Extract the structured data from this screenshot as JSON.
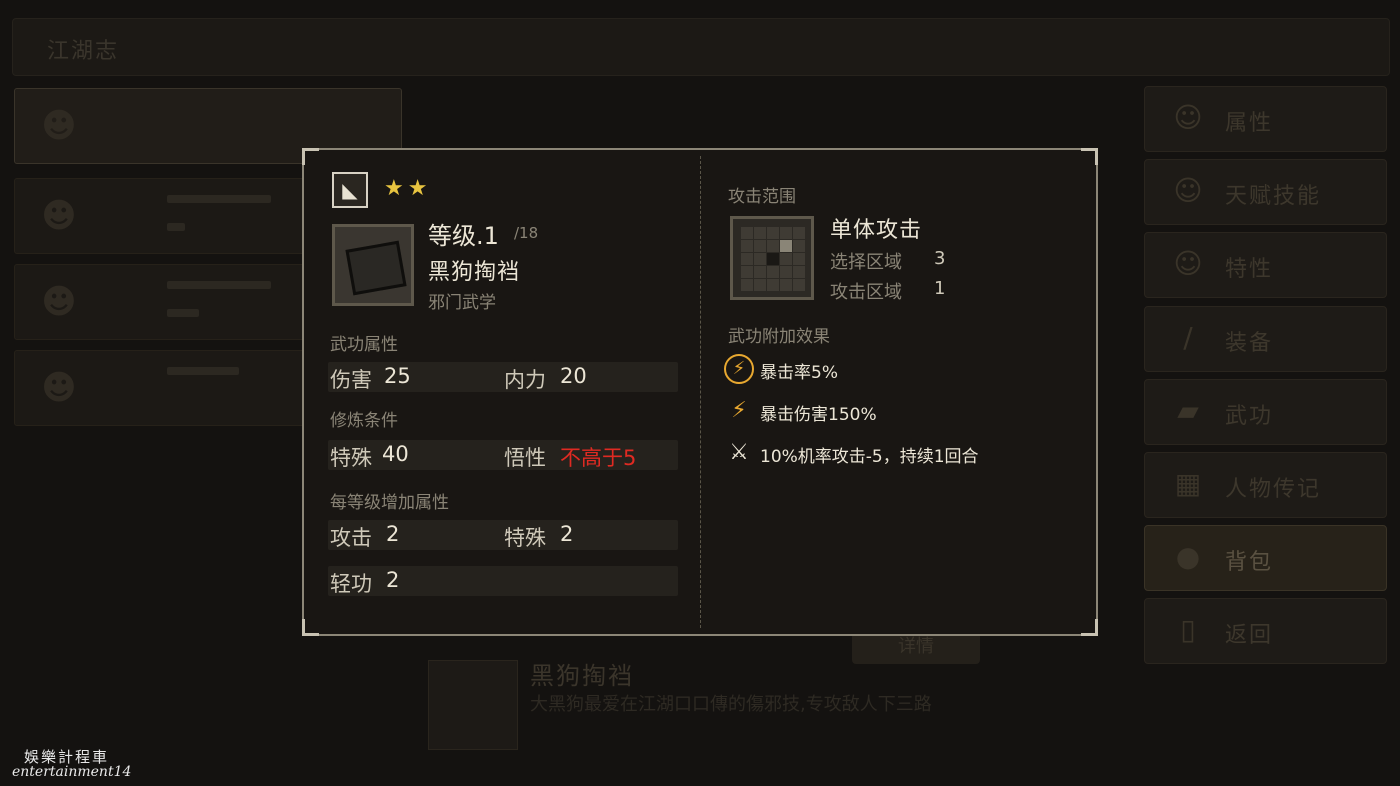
{
  "background": {
    "top_title": "江湖志",
    "menu": [
      {
        "label": "属性",
        "icon": "person-icon"
      },
      {
        "label": "天赋技能",
        "icon": "talent-icon"
      },
      {
        "label": "特性",
        "icon": "trait-icon"
      },
      {
        "label": "装备",
        "icon": "sword-icon"
      },
      {
        "label": "武功",
        "icon": "book-icon"
      },
      {
        "label": "人物传记",
        "icon": "scroll-icon"
      },
      {
        "label": "背包",
        "icon": "bag-icon"
      },
      {
        "label": "返回",
        "icon": "door-icon"
      }
    ],
    "bottom_item_name": "黑狗掏裆",
    "bottom_item_desc": "大黑狗最爱在江湖口口傳的傷邪技,专攻敌人下三路",
    "tab_label": "详情"
  },
  "modal": {
    "stars": "★★",
    "level_label": "等级.1",
    "level_max": "/18",
    "item_name": "黑狗掏裆",
    "item_category": "邪门武学",
    "section_attrs": "武功属性",
    "attrs": [
      {
        "label": "伤害",
        "value": "25"
      },
      {
        "label": "内力",
        "value": "20"
      }
    ],
    "section_requirements": "修炼条件",
    "requirements": [
      {
        "label": "特殊",
        "value": "40"
      },
      {
        "label": "悟性",
        "value": "不高于5"
      }
    ],
    "section_per_level": "每等级增加属性",
    "per_level": [
      {
        "label": "攻击",
        "value": "2"
      },
      {
        "label": "特殊",
        "value": "2"
      },
      {
        "label": "轻功",
        "value": "2"
      }
    ],
    "attack_range_title": "攻击范围",
    "attack_type": "单体攻击",
    "select_zone_label": "选择区域",
    "select_zone_value": "3",
    "attack_zone_label": "攻击区域",
    "attack_zone_value": "1",
    "extra_effects_title": "武功附加效果",
    "effects": [
      {
        "icon": "crit-rate-icon",
        "text": "暴击率5%"
      },
      {
        "icon": "crit-damage-icon",
        "text": "暴击伤害150%"
      },
      {
        "icon": "debuff-sword-icon",
        "text": "10%机率攻击-5，持续1回合"
      }
    ]
  },
  "watermark": {
    "line1": "娛樂計程車",
    "line2": "entertainment14"
  },
  "colors": {
    "accent_red": "#e02a22",
    "star": "#e8c440",
    "effect_icon": "#e8a830"
  }
}
